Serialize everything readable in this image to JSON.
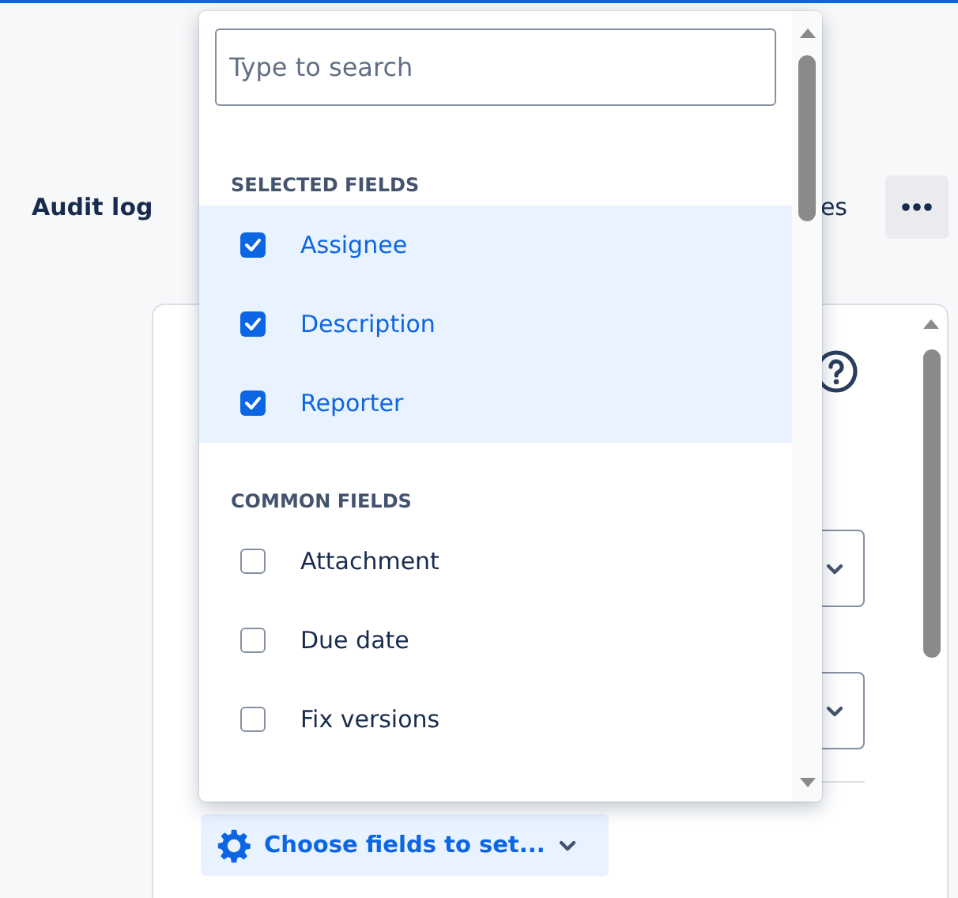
{
  "page": {
    "title": "Audit log",
    "partial_tab": "es"
  },
  "field_picker": {
    "search": {
      "placeholder": "Type to search"
    },
    "sections": [
      {
        "heading": "SELECTED FIELDS",
        "items": [
          {
            "label": "Assignee",
            "checked": true
          },
          {
            "label": "Description",
            "checked": true
          },
          {
            "label": "Reporter",
            "checked": true
          }
        ]
      },
      {
        "heading": "COMMON FIELDS",
        "items": [
          {
            "label": "Attachment",
            "checked": false
          },
          {
            "label": "Due date",
            "checked": false
          },
          {
            "label": "Fix versions",
            "checked": false
          }
        ]
      }
    ]
  },
  "choose_button": {
    "label": "Choose fields to set..."
  }
}
